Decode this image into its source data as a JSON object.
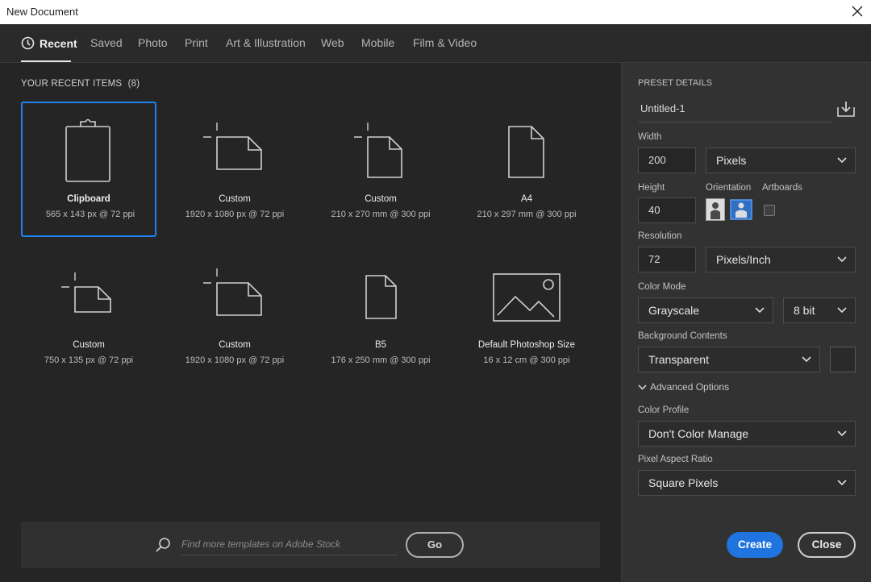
{
  "window": {
    "title": "New Document"
  },
  "tabs": [
    {
      "label": "Recent",
      "active": true
    },
    {
      "label": "Saved"
    },
    {
      "label": "Photo"
    },
    {
      "label": "Print"
    },
    {
      "label": "Art & Illustration"
    },
    {
      "label": "Web"
    },
    {
      "label": "Mobile"
    },
    {
      "label": "Film & Video"
    }
  ],
  "recent": {
    "heading": "YOUR RECENT ITEMS",
    "count": "(8)",
    "items": [
      {
        "name": "Clipboard",
        "desc": "565 x 143 px @ 72 ppi",
        "icon": "clipboard-icon",
        "selected": true
      },
      {
        "name": "Custom",
        "desc": "1920 x 1080 px @ 72 ppi",
        "icon": "custom-landscape-icon"
      },
      {
        "name": "Custom",
        "desc": "210 x 270 mm @ 300 ppi",
        "icon": "custom-portrait-icon"
      },
      {
        "name": "A4",
        "desc": "210 x 297 mm @ 300 ppi",
        "icon": "document-icon"
      },
      {
        "name": "Custom",
        "desc": "750 x 135 px @ 72 ppi",
        "icon": "custom-landscape-icon"
      },
      {
        "name": "Custom",
        "desc": "1920 x 1080 px @ 72 ppi",
        "icon": "custom-landscape-icon"
      },
      {
        "name": "B5",
        "desc": "176 x 250 mm @ 300 ppi",
        "icon": "document-icon"
      },
      {
        "name": "Default Photoshop Size",
        "desc": "16 x 12 cm @ 300 ppi",
        "icon": "image-icon"
      }
    ]
  },
  "search": {
    "placeholder": "Find more templates on Adobe Stock",
    "go_label": "Go"
  },
  "preset": {
    "heading": "PRESET DETAILS",
    "name": "Untitled-1",
    "width_label": "Width",
    "width_value": "200",
    "width_unit": "Pixels",
    "height_label": "Height",
    "height_value": "40",
    "orientation_label": "Orientation",
    "artboards_label": "Artboards",
    "resolution_label": "Resolution",
    "resolution_value": "72",
    "resolution_unit": "Pixels/Inch",
    "color_mode_label": "Color Mode",
    "color_mode": "Grayscale",
    "bit_depth": "8 bit",
    "bg_label": "Background Contents",
    "bg_value": "Transparent",
    "advanced_label": "Advanced Options",
    "profile_label": "Color Profile",
    "profile_value": "Don't Color Manage",
    "par_label": "Pixel Aspect Ratio",
    "par_value": "Square Pixels"
  },
  "actions": {
    "create_label": "Create",
    "close_label": "Close"
  },
  "colors": {
    "accent": "#1f74e0",
    "selection": "#1f82f0",
    "panel": "#323232",
    "background": "#252525"
  }
}
